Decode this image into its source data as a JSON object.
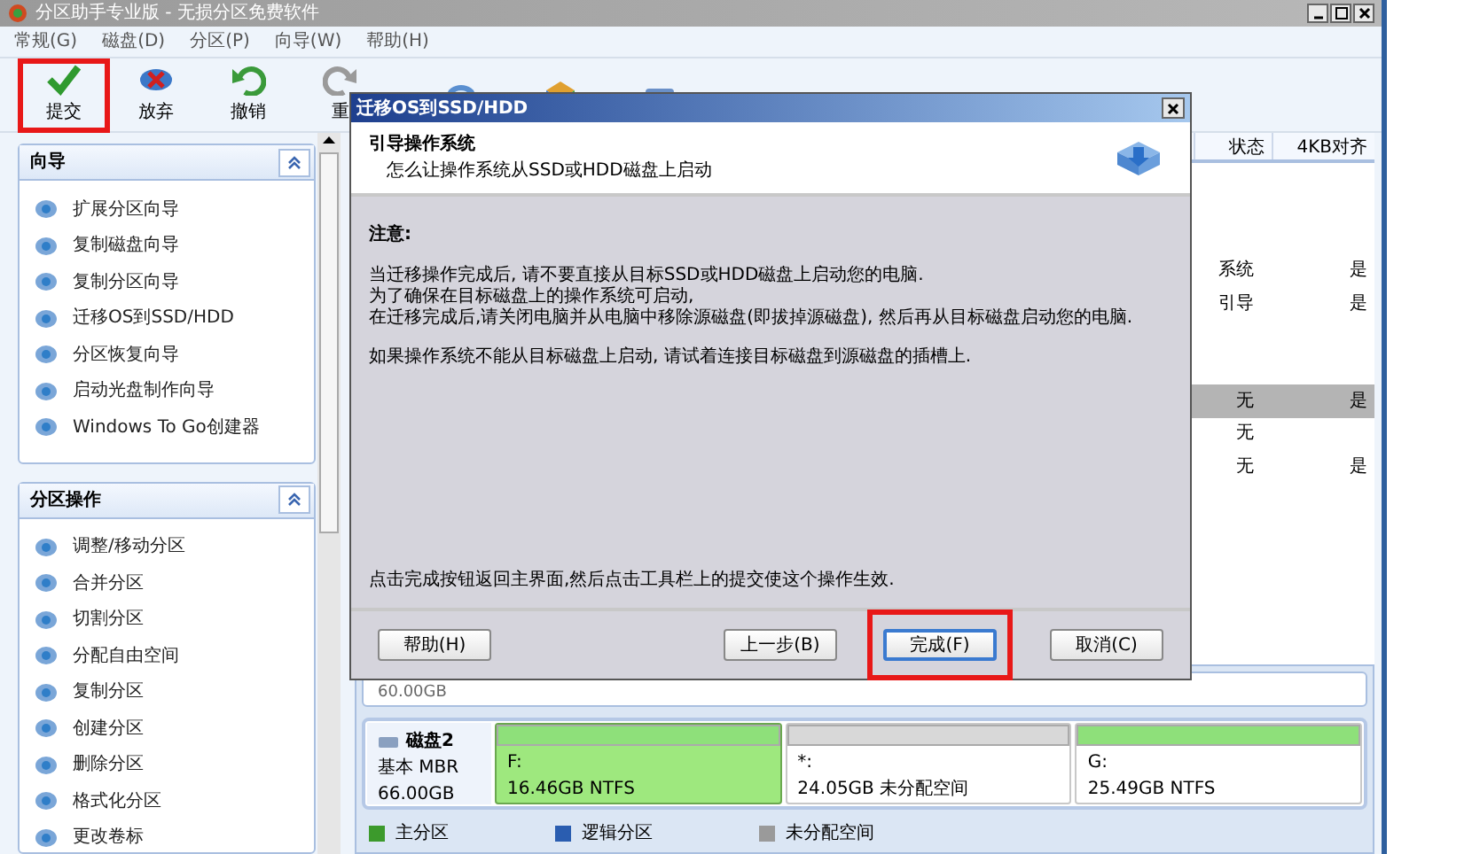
{
  "window": {
    "title": "分区助手专业版 - 无损分区免费软件"
  },
  "menu": [
    "常规(G)",
    "磁盘(D)",
    "分区(P)",
    "向导(W)",
    "帮助(H)"
  ],
  "toolbar": [
    {
      "kind": "check",
      "label": "提交",
      "highlighted": true
    },
    {
      "kind": "discard",
      "label": "放弃",
      "highlighted": false
    },
    {
      "kind": "undo",
      "label": "撤销",
      "highlighted": false
    },
    {
      "kind": "redo",
      "label": "重",
      "highlighted": false
    },
    {
      "kind": "disk",
      "highlighted": false
    },
    {
      "kind": "box",
      "highlighted": false
    },
    {
      "kind": "drive",
      "highlighted": false
    }
  ],
  "sidebar": {
    "panels": [
      {
        "title": "向导",
        "items": [
          "扩展分区向导",
          "复制磁盘向导",
          "复制分区向导",
          "迁移OS到SSD/HDD",
          "分区恢复向导",
          "启动光盘制作向导",
          "Windows To Go创建器"
        ]
      },
      {
        "title": "分区操作",
        "items": [
          "调整/移动分区",
          "合并分区",
          "切割分区",
          "分配自由空间",
          "复制分区",
          "创建分区",
          "删除分区",
          "格式化分区",
          "更改卷标"
        ]
      }
    ]
  },
  "table": {
    "columns": [
      "状态",
      "4KB对齐"
    ],
    "rows": [
      {
        "selected": false
      },
      {
        "status": "系统",
        "aligned": "是",
        "selected": false
      },
      {
        "status": "引导",
        "aligned": "是",
        "selected": false
      },
      {
        "selected": false
      },
      {
        "status": "无",
        "aligned": "是",
        "selected": true
      },
      {
        "status": "无",
        "selected": false
      },
      {
        "status": "无",
        "aligned": "是",
        "selected": false
      }
    ]
  },
  "disks": [
    {
      "size": "60.00GB"
    },
    {
      "name": "磁盘2",
      "type": "基本 MBR",
      "size": "66.00GB",
      "partitions": [
        {
          "kind": "primary",
          "letter": "F:",
          "info": "16.46GB NTFS",
          "selected": true
        },
        {
          "kind": "unallocated",
          "letter": "*:",
          "info": "24.05GB 未分配空间",
          "selected": false
        },
        {
          "kind": "primary",
          "letter": "G:",
          "info": "25.49GB NTFS",
          "selected": false
        }
      ]
    }
  ],
  "legend": [
    {
      "label": "主分区",
      "color": "#3c9a2c"
    },
    {
      "label": "逻辑分区",
      "color": "#2a5db0"
    },
    {
      "label": "未分配空间",
      "color": "#9a9a9a"
    }
  ],
  "dialog": {
    "title": "迁移OS到SSD/HDD",
    "heading": "引导操作系统",
    "subheading": "怎么让操作系统从SSD或HDD磁盘上启动",
    "note_title": "注意:",
    "paragraphs": [
      [
        "当迁移操作完成后, 请不要直接从目标SSD或HDD磁盘上启动您的电脑.",
        "为了确保在目标磁盘上的操作系统可启动,",
        "在迁移完成后,请关闭电脑并从电脑中移除源磁盘(即拔掉源磁盘), 然后再从目标磁盘启动您的电脑."
      ],
      [
        "如果操作系统不能从目标磁盘上启动, 请试着连接目标磁盘到源磁盘的插槽上."
      ]
    ],
    "footer": "点击完成按钮返回主界面,然后点击工具栏上的提交使这个操作生效.",
    "buttons": [
      {
        "label": "帮助(H)",
        "focused": false,
        "highlighted": false
      },
      {
        "label": "上一步(B)",
        "focused": false,
        "highlighted": false
      },
      {
        "label": "完成(F)",
        "focused": true,
        "highlighted": true
      },
      {
        "label": "取消(C)",
        "focused": false,
        "highlighted": false
      }
    ]
  }
}
